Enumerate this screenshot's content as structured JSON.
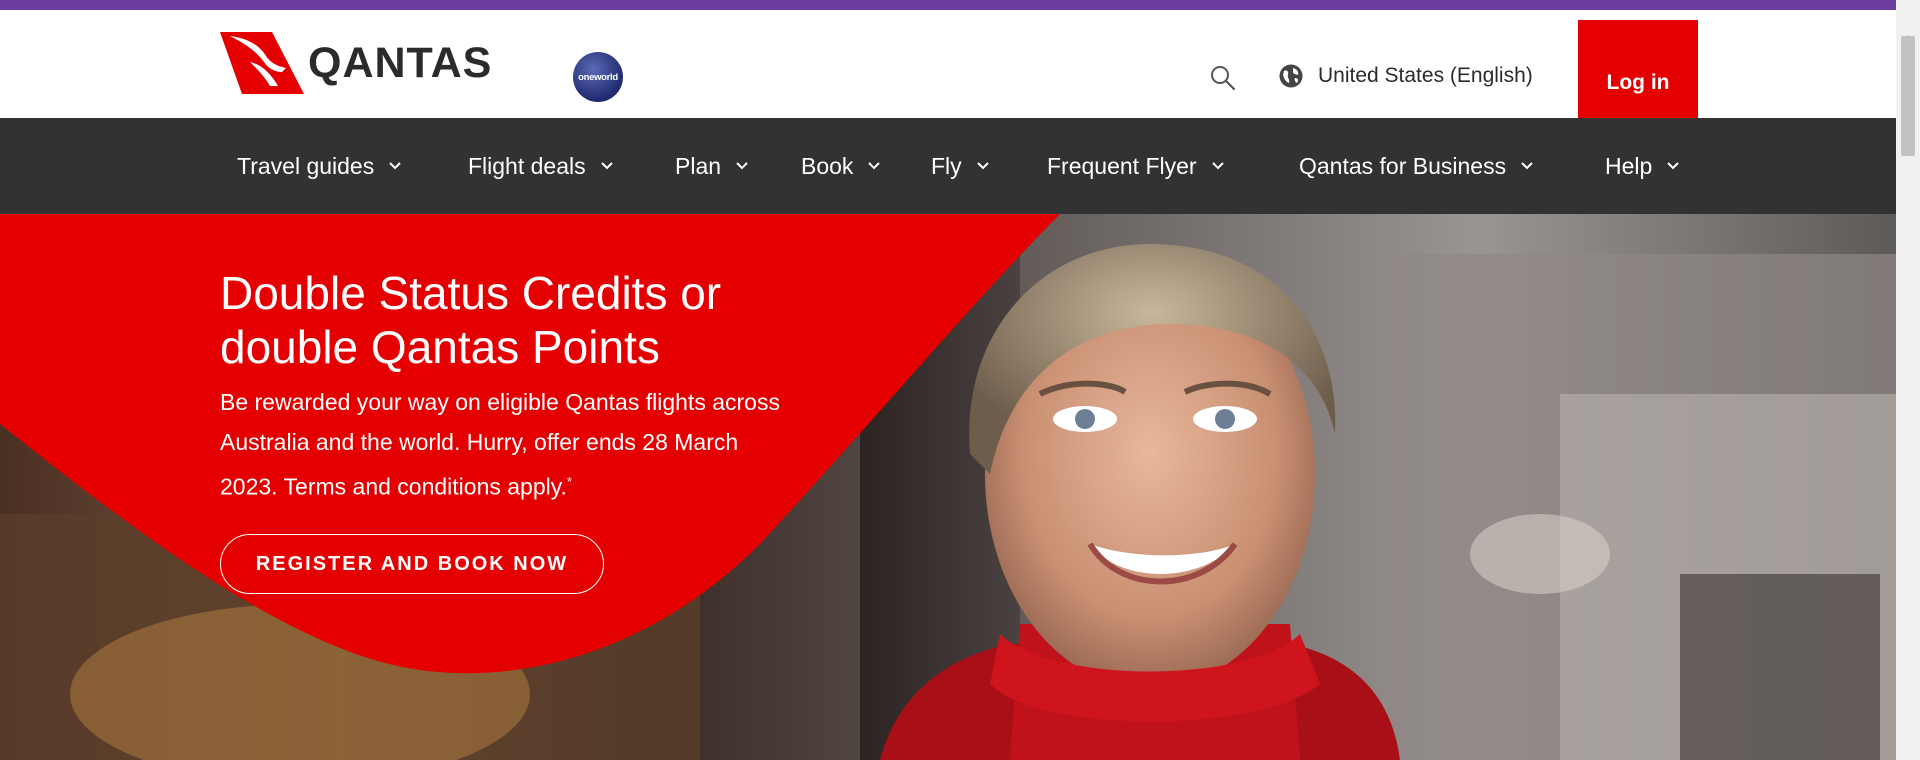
{
  "brand": {
    "logo_text": "QANTAS",
    "logo_icon": "kangaroo-tail-logo",
    "partner_badge_text": "oneworld",
    "accent_color": "#e40000",
    "nav_bg_color": "#323232",
    "top_stripe_color": "#6a3d9e"
  },
  "header": {
    "search_icon": "search-icon",
    "locale_icon": "globe-icon",
    "locale_label": "United States (English)",
    "login_label": "Log in"
  },
  "nav": {
    "items": [
      {
        "label": "Travel guides"
      },
      {
        "label": "Flight deals"
      },
      {
        "label": "Plan"
      },
      {
        "label": "Book"
      },
      {
        "label": "Fly"
      },
      {
        "label": "Frequent Flyer"
      },
      {
        "label": "Qantas for Business"
      },
      {
        "label": "Help"
      }
    ],
    "chevron_icon": "chevron-down-icon"
  },
  "hero": {
    "headline": "Double Status Credits or double Qantas Points",
    "body": "Be rewarded your way on eligible Qantas flights across Australia and the world. Hurry, offer ends 28 March 2023. Terms and conditions apply.",
    "footnote_marker": "*",
    "cta_label": "REGISTER AND BOOK NOW",
    "image": "smiling-flight-attendant-photo"
  }
}
